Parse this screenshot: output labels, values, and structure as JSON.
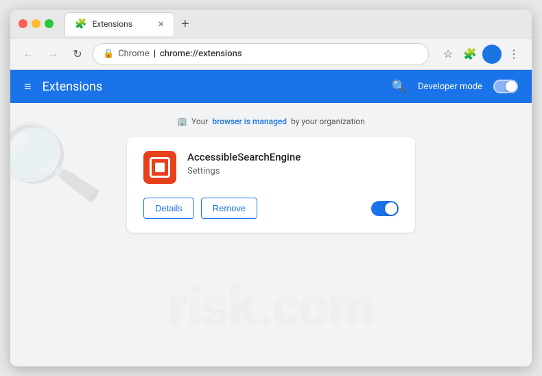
{
  "browser": {
    "tab": {
      "icon": "🧩",
      "label": "Extensions",
      "close": "×",
      "new_tab": "+"
    },
    "address_bar": {
      "lock_icon": "🔒",
      "origin": "Chrome",
      "separator": "|",
      "path": "chrome://extensions",
      "star_icon": "☆",
      "ext_icon": "🧩",
      "profile_icon": "👤",
      "menu_icon": "⋮"
    },
    "nav": {
      "back": "←",
      "forward": "→",
      "refresh": "↻"
    }
  },
  "extensions_page": {
    "header": {
      "menu_icon": "≡",
      "title": "Extensions",
      "search_icon": "🔍",
      "developer_mode_label": "Developer mode"
    },
    "managed_notice": {
      "icon": "🏢",
      "text_before": "Your",
      "link_text": "browser is managed",
      "text_after": "by your organization"
    },
    "extension": {
      "name": "AccessibleSearchEngine",
      "settings_label": "Settings",
      "details_label": "Details",
      "remove_label": "Remove"
    },
    "colors": {
      "blue": "#1a73e8",
      "header_bg": "#1a73e8",
      "ext_icon_bg": "#e8401c",
      "page_bg": "#f1f3f4"
    }
  }
}
